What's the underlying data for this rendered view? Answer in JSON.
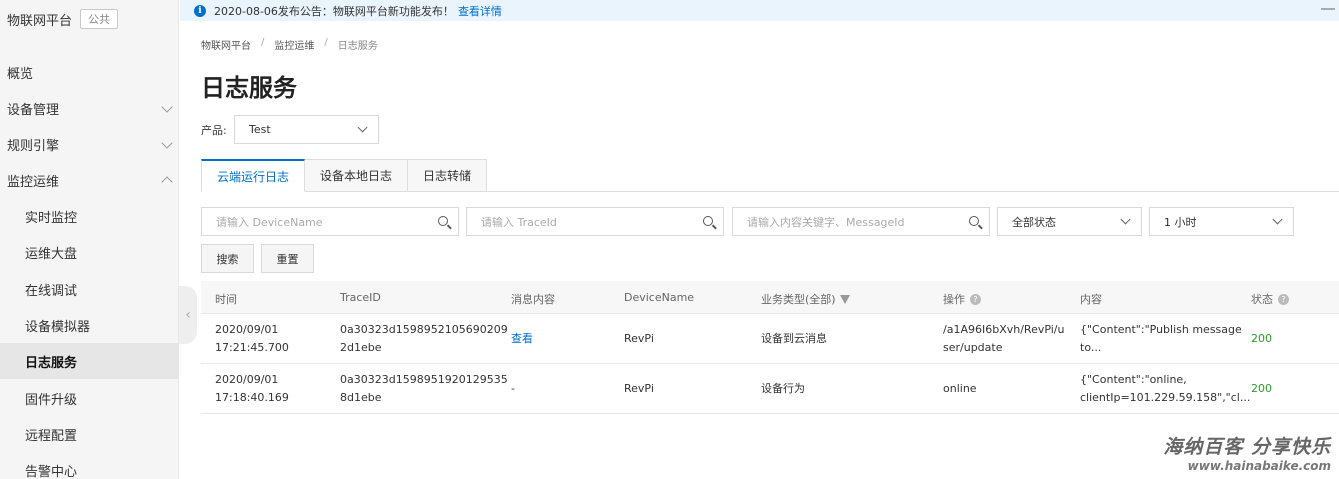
{
  "sidebar": {
    "brand": "物联网平台",
    "brand_tag": "公共",
    "items": [
      {
        "label": "概览"
      },
      {
        "label": "设备管理"
      },
      {
        "label": "规则引擎"
      },
      {
        "label": "监控运维"
      },
      {
        "label": "实时监控"
      },
      {
        "label": "运维大盘"
      },
      {
        "label": "在线调试"
      },
      {
        "label": "设备模拟器"
      },
      {
        "label": "日志服务"
      },
      {
        "label": "固件升级"
      },
      {
        "label": "远程配置"
      },
      {
        "label": "告警中心"
      }
    ]
  },
  "announcement": {
    "text": "2020-08-06发布公告：物联网平台新功能发布！",
    "link": "查看详情"
  },
  "breadcrumb": [
    "物联网平台",
    "/",
    "监控运维",
    "/",
    "日志服务"
  ],
  "page_title": "日志服务",
  "product": {
    "label": "产品:",
    "value": "Test"
  },
  "tabs": [
    {
      "label": "云端运行日志"
    },
    {
      "label": "设备本地日志"
    },
    {
      "label": "日志转储"
    }
  ],
  "filters": {
    "device_placeholder": "请输入 DeviceName",
    "trace_placeholder": "请输入 TraceId",
    "keyword_placeholder": "请输入内容关键字、MessageId",
    "status_value": "全部状态",
    "time_value": "1 小时",
    "search_label": "搜索",
    "reset_label": "重置"
  },
  "table": {
    "headers": [
      "时间",
      "TraceID",
      "消息内容",
      "DeviceName",
      "业务类型(全部)",
      "操作",
      "内容",
      "状态"
    ],
    "rows": [
      {
        "date": "2020/09/01",
        "time": "17:21:45.700",
        "trace1": "0a30323d1598952105690209",
        "trace2": "2d1ebe",
        "message": "查看",
        "device": "RevPi",
        "biz": "设备到云消息",
        "op1": "/a1A96I6bXvh/RevPi/u",
        "op2": "ser/update",
        "content1": "{\"Content\":\"Publish message",
        "content2": "to...",
        "status": "200"
      },
      {
        "date": "2020/09/01",
        "time": "17:18:40.169",
        "trace1": "0a30323d1598951920129535",
        "trace2": "8d1ebe",
        "message": "-",
        "device": "RevPi",
        "biz": "设备行为",
        "op1": "online",
        "op2": "",
        "content1": "{\"Content\":\"online,",
        "content2": "clientIp=101.229.59.158\",\"cl...",
        "status": "200"
      }
    ]
  },
  "watermark": {
    "line1": "海纳百客 分享快乐",
    "line2": "www.hainabaike.com"
  }
}
